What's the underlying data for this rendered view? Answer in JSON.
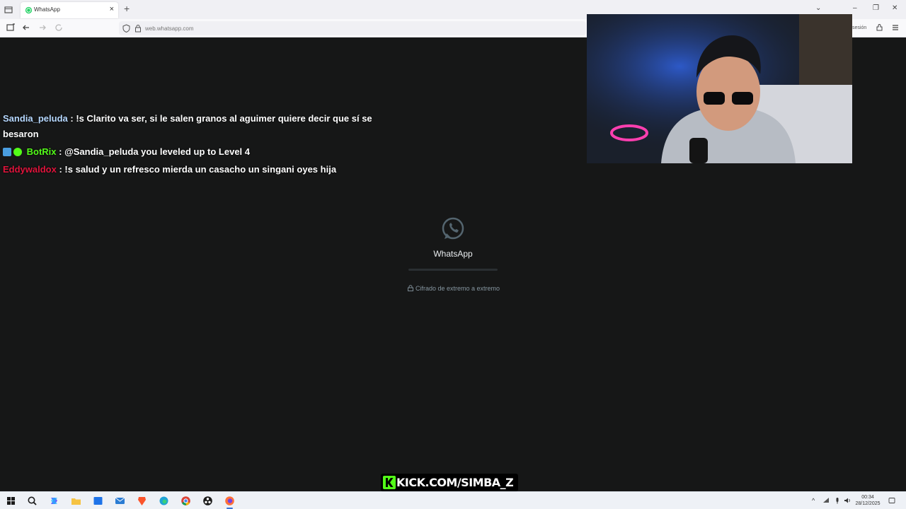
{
  "browser": {
    "tab": {
      "title": "WhatsApp"
    },
    "url": "web.whatsapp.com",
    "account_text": "sesión"
  },
  "whatsapp": {
    "app_name": "WhatsApp",
    "encryption_text": "Cifrado de extremo a extremo",
    "loading_progress": 0,
    "accent_color": "#00a884"
  },
  "chat": [
    {
      "user": "Sandia_peluda",
      "user_color": "#b6d8ff",
      "text": ": !s Clarito va ser, si le salen granos al aguimer quiere decir que sí se besaron"
    },
    {
      "user": "BotRix",
      "user_color": "#53fc18",
      "text": ": @Sandia_peluda you leveled up to Level 4",
      "badges": [
        "bot-badge-icon",
        "verified-badge-icon"
      ]
    },
    {
      "user": "Eddywaldox",
      "user_color": "#e0143c",
      "text": ": !s salud y un refresco mierda un casacho un singani oyes hija"
    }
  ],
  "watermark": {
    "text": "KICK.COM/SIMBA_Z",
    "brand_color": "#53fc18"
  },
  "taskbar": {
    "apps": [
      "start-icon",
      "search-icon",
      "copilot-icon",
      "file-explorer-icon",
      "store-icon",
      "outlook-icon",
      "brave-icon",
      "edge-icon",
      "chrome-icon",
      "obs-icon",
      "firefox-icon"
    ],
    "time": "00:34",
    "date": "28/12/2025"
  }
}
